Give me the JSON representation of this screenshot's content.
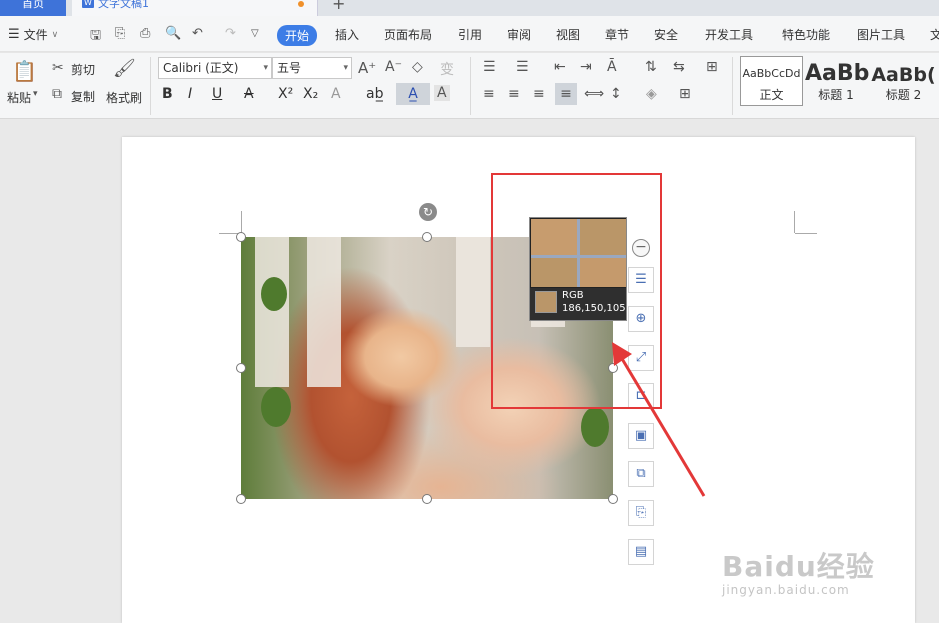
{
  "tabs": {
    "home": "首页",
    "doc": "文字文稿1",
    "new_tab": "+"
  },
  "menubar": {
    "file": "文件",
    "tabs": [
      "开始",
      "插入",
      "页面布局",
      "引用",
      "审阅",
      "视图",
      "章节",
      "安全",
      "开发工具",
      "特色功能",
      "图片工具",
      "文"
    ]
  },
  "ribbon": {
    "paste": "粘贴",
    "cut": "剪切",
    "copy": "复制",
    "format_painter": "格式刷",
    "font_name": "Calibri (正文)",
    "font_size": "五号",
    "style_normal_sample": "AaBbCcDd",
    "style_normal": "正文",
    "style_h1_sample": "AaBb",
    "style_h1": "标题 1",
    "style_h2_sample": "AaBb(",
    "style_h2": "标题 2"
  },
  "color_picker": {
    "label": "RGB",
    "value": "186,150,105",
    "swatch_color": "#ba9669"
  },
  "watermark": {
    "brand": "Baidu经验",
    "url": "jingyan.baidu.com"
  },
  "colors": {
    "accent": "#3d7de6",
    "highlight": "#e33838"
  }
}
